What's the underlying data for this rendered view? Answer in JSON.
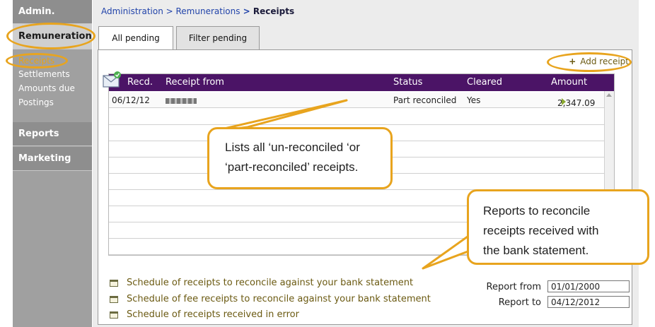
{
  "sidebar": {
    "admin": "Admin.",
    "remuneration": "Remuneration",
    "items": [
      {
        "label": "Receipts"
      },
      {
        "label": "Settlements"
      },
      {
        "label": "Amounts due"
      },
      {
        "label": "Postings"
      }
    ],
    "reports": "Reports",
    "marketing": "Marketing"
  },
  "breadcrumb": {
    "part1": "Administration",
    "sep1": " > ",
    "part2": "Remunerations",
    "sep2": " > ",
    "current": "Receipts"
  },
  "tabs": [
    {
      "label": "All pending"
    },
    {
      "label": "Filter pending"
    }
  ],
  "toolbar": {
    "add_receipt": "Add receipt",
    "add_icon": "+"
  },
  "grid": {
    "columns": [
      "Recd.",
      "Receipt from",
      "Status",
      "Cleared",
      "Amount"
    ],
    "rows": [
      {
        "recd": "06/12/12",
        "status": "Part reconciled",
        "cleared": "Yes",
        "amount": "2,347.09"
      }
    ]
  },
  "callouts": {
    "lists": [
      "Lists all ‘un-reconciled ‘or",
      "‘part-reconciled’ receipts."
    ],
    "reports": [
      "Reports to reconcile",
      "receipts received with",
      "the bank statement."
    ]
  },
  "report_links": [
    {
      "label": "Schedule of receipts to reconcile against your bank statement"
    },
    {
      "label": "Schedule of fee receipts to reconcile against your bank statement"
    },
    {
      "label": "Schedule of receipts received in error"
    }
  ],
  "report_range": {
    "from_label": "Report from",
    "from_value": "01/01/2000",
    "to_label": "Report to",
    "to_value": "04/12/2012"
  },
  "colors": {
    "header_purple": "#4b1466",
    "highlight_orange": "#e8a41e",
    "link_olive": "#6b5a12"
  },
  "icons": {
    "add": "plus-icon",
    "envelope": "envelope-icon",
    "printer": "printer-icon",
    "row_arrow": "arrow-right-icon"
  }
}
